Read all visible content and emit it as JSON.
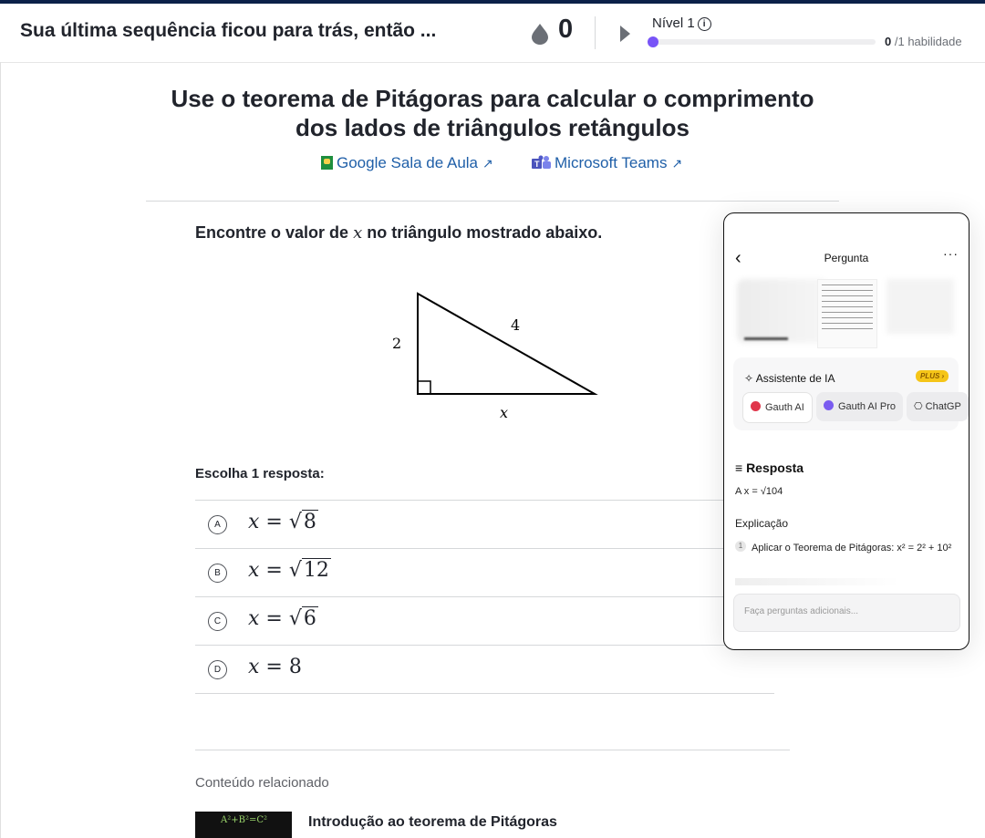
{
  "header": {
    "streak_message": "Sua última sequência ficou para trás, então ...",
    "streak_count": "0",
    "level_label": "Nível 1",
    "skills_done": "0",
    "skills_total": "/1 habilidade",
    "level_progress": 0
  },
  "lesson": {
    "title": "Use o teorema de Pitágoras para calcular o comprimento dos lados de triângulos retângulos",
    "share_google": "Google Sala de Aula",
    "share_teams": "Microsoft Teams"
  },
  "question": {
    "prompt_before": "Encontre o valor de",
    "prompt_var": "x",
    "prompt_after": "no triângulo mostrado abaixo.",
    "triangle": {
      "left_side": "2",
      "hypotenuse": "4",
      "bottom_side": "x"
    },
    "choose_label": "Escolha 1 resposta:",
    "choices": [
      {
        "letter": "A",
        "var": "x",
        "eq": "=",
        "radicand": "8"
      },
      {
        "letter": "B",
        "var": "x",
        "eq": "=",
        "radicand": "12"
      },
      {
        "letter": "C",
        "var": "x",
        "eq": "=",
        "radicand": "6"
      },
      {
        "letter": "D",
        "var": "x",
        "eq": "=",
        "value": "8"
      }
    ]
  },
  "related": {
    "heading": "Conteúdo relacionado",
    "video_title": "Introdução ao teorema de Pitágoras"
  },
  "overlay": {
    "title": "Pergunta",
    "ai_title": "Assistente de IA",
    "plus_badge": "PLUS ›",
    "chips": [
      "Gauth AI",
      "Gauth AI Pro",
      "ChatGP"
    ],
    "response_heading": "Resposta",
    "answer": "A x = √104",
    "explanation_heading": "Explicação",
    "step_number": "1",
    "step_text": "Aplicar o Teorema de Pitágoras: x² = 2² + 10²",
    "input_placeholder": "Faça perguntas adicionais...",
    "colors": {
      "chip_gauth": "#e0364b",
      "chip_pro": "#7a5cf0",
      "plus": "#f5c518"
    }
  }
}
